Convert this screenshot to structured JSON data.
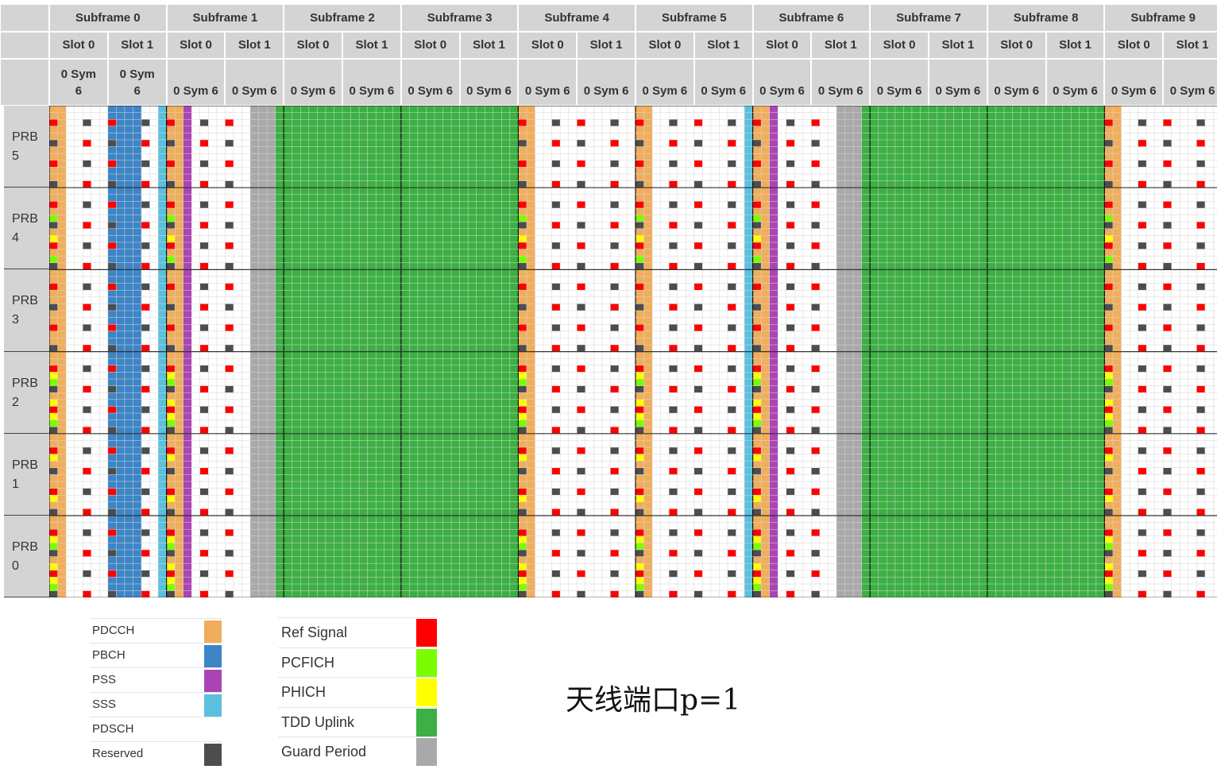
{
  "header": {
    "subframes": [
      "Subframe 0",
      "Subframe 1",
      "Subframe 2",
      "Subframe 3",
      "Subframe 4",
      "Subframe 5",
      "Subframe 6",
      "Subframe 7",
      "Subframe 8",
      "Subframe 9"
    ],
    "slot_labels": [
      "Slot 0",
      "Slot 1"
    ],
    "symbol_label": "0 Sym 6"
  },
  "prb_rows": [
    {
      "word": "PRB",
      "num": "5"
    },
    {
      "word": "PRB",
      "num": "4"
    },
    {
      "word": "PRB",
      "num": "3"
    },
    {
      "word": "PRB",
      "num": "2"
    },
    {
      "word": "PRB",
      "num": "1"
    },
    {
      "word": "PRB",
      "num": "0"
    }
  ],
  "frame": {
    "subframe_types": [
      "D",
      "S",
      "U",
      "U",
      "D",
      "D",
      "S",
      "U",
      "U",
      "D"
    ],
    "antenna_port": 1,
    "subcarriers_per_prb": 12,
    "symbols_per_slot": 7,
    "special_subframe": {
      "dwpts_symbols": 10,
      "guard_symbols": 3,
      "uppts_symbols": 1
    }
  },
  "legend_left": [
    {
      "label": "PDCCH",
      "color": "#f0ae5c"
    },
    {
      "label": "PBCH",
      "color": "#3d85c6"
    },
    {
      "label": "PSS",
      "color": "#ab44b5"
    },
    {
      "label": "SSS",
      "color": "#5bc0de"
    },
    {
      "label": "PDSCH",
      "color": "#ffffff"
    },
    {
      "label": "Reserved",
      "color": "#4d4d4d"
    }
  ],
  "legend_right": [
    {
      "label": "Ref Signal",
      "color": "#ff0000"
    },
    {
      "label": "PCFICH",
      "color": "#7cfc00"
    },
    {
      "label": "PHICH",
      "color": "#ffff00"
    },
    {
      "label": "TDD Uplink",
      "color": "#3cb043"
    },
    {
      "label": "Guard Period",
      "color": "#a9a9a9"
    }
  ],
  "caption": "天线端口p=1"
}
